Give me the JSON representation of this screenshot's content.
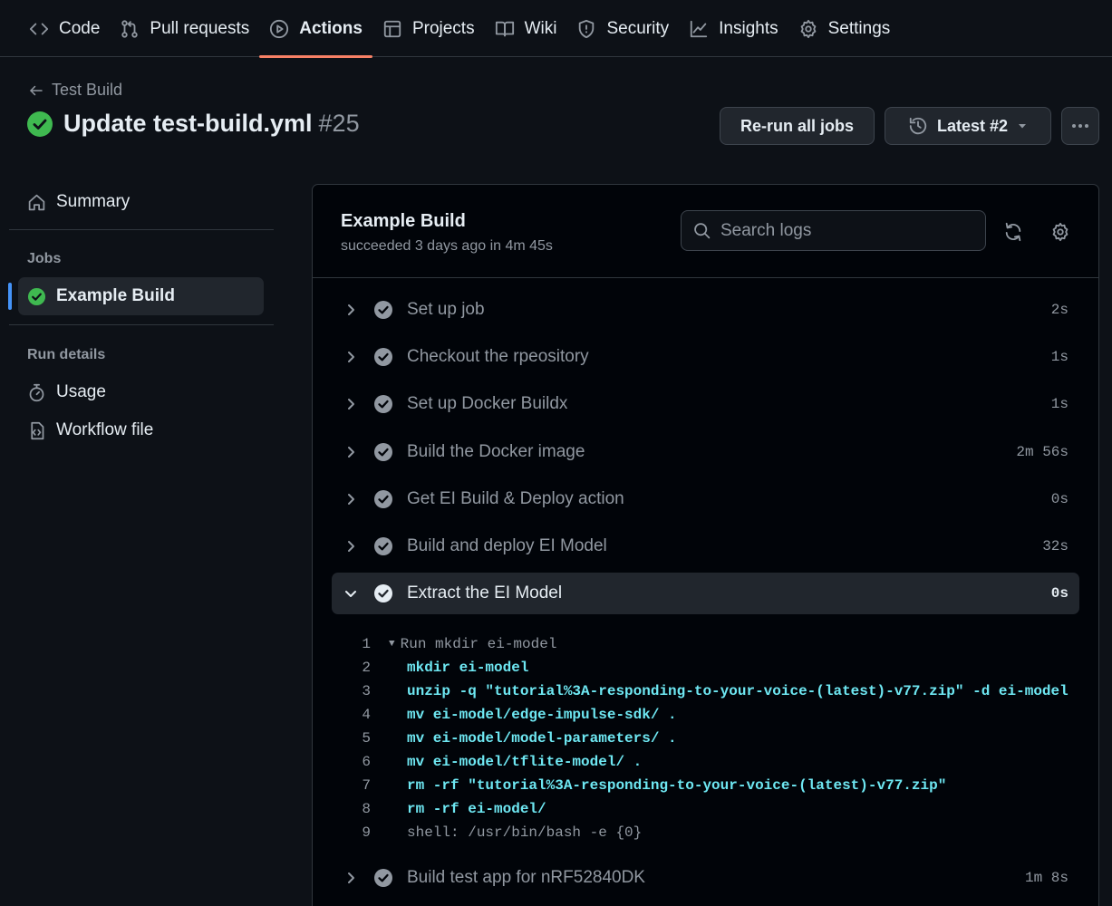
{
  "nav": {
    "tabs": [
      {
        "label": "Code",
        "icon": "code-icon"
      },
      {
        "label": "Pull requests",
        "icon": "git-pull-request-icon"
      },
      {
        "label": "Actions",
        "icon": "play-icon",
        "active": true
      },
      {
        "label": "Projects",
        "icon": "table-icon"
      },
      {
        "label": "Wiki",
        "icon": "book-icon"
      },
      {
        "label": "Security",
        "icon": "shield-icon"
      },
      {
        "label": "Insights",
        "icon": "graph-icon"
      },
      {
        "label": "Settings",
        "icon": "gear-icon"
      }
    ]
  },
  "header": {
    "back_label": "Test Build",
    "title": "Update test-build.yml",
    "run_number": "#25",
    "rerun_label": "Re-run all jobs",
    "attempt_label": "Latest #2"
  },
  "sidebar": {
    "summary_label": "Summary",
    "jobs_heading": "Jobs",
    "job_label": "Example Build",
    "run_details_heading": "Run details",
    "usage_label": "Usage",
    "workflow_label": "Workflow file"
  },
  "job": {
    "title": "Example Build",
    "subtitle": "succeeded 3 days ago in 4m 45s",
    "search_placeholder": "Search logs"
  },
  "steps": [
    {
      "name": "Set up job",
      "duration": "2s"
    },
    {
      "name": "Checkout the rpeository",
      "duration": "1s"
    },
    {
      "name": "Set up Docker Buildx",
      "duration": "1s"
    },
    {
      "name": "Build the Docker image",
      "duration": "2m 56s"
    },
    {
      "name": "Get EI Build & Deploy action",
      "duration": "0s"
    },
    {
      "name": "Build and deploy EI Model",
      "duration": "32s"
    },
    {
      "name": "Extract the EI Model",
      "duration": "0s",
      "expanded": true
    },
    {
      "name": "Build test app for nRF52840DK",
      "duration": "1m 8s"
    }
  ],
  "log_lines": [
    {
      "num": "1",
      "text": "Run mkdir ei-model",
      "kind": "group"
    },
    {
      "num": "2",
      "text": "mkdir ei-model",
      "kind": "cmd"
    },
    {
      "num": "3",
      "text": "unzip -q \"tutorial%3A-responding-to-your-voice-(latest)-v77.zip\" -d ei-model",
      "kind": "cmd"
    },
    {
      "num": "4",
      "text": "mv ei-model/edge-impulse-sdk/ .",
      "kind": "cmd"
    },
    {
      "num": "5",
      "text": "mv ei-model/model-parameters/ .",
      "kind": "cmd"
    },
    {
      "num": "6",
      "text": "mv ei-model/tflite-model/ .",
      "kind": "cmd"
    },
    {
      "num": "7",
      "text": "rm -rf \"tutorial%3A-responding-to-your-voice-(latest)-v77.zip\"",
      "kind": "cmd"
    },
    {
      "num": "8",
      "text": "rm -rf ei-model/",
      "kind": "cmd"
    },
    {
      "num": "9",
      "text": "shell: /usr/bin/bash -e {0}",
      "kind": "plain"
    }
  ],
  "colors": {
    "background": "#0d1117",
    "panel": "#010409",
    "success": "#3fb950",
    "active_tab_underline": "#f78166",
    "selected_indicator": "#4493f8",
    "log_command": "#6ee7f2"
  }
}
